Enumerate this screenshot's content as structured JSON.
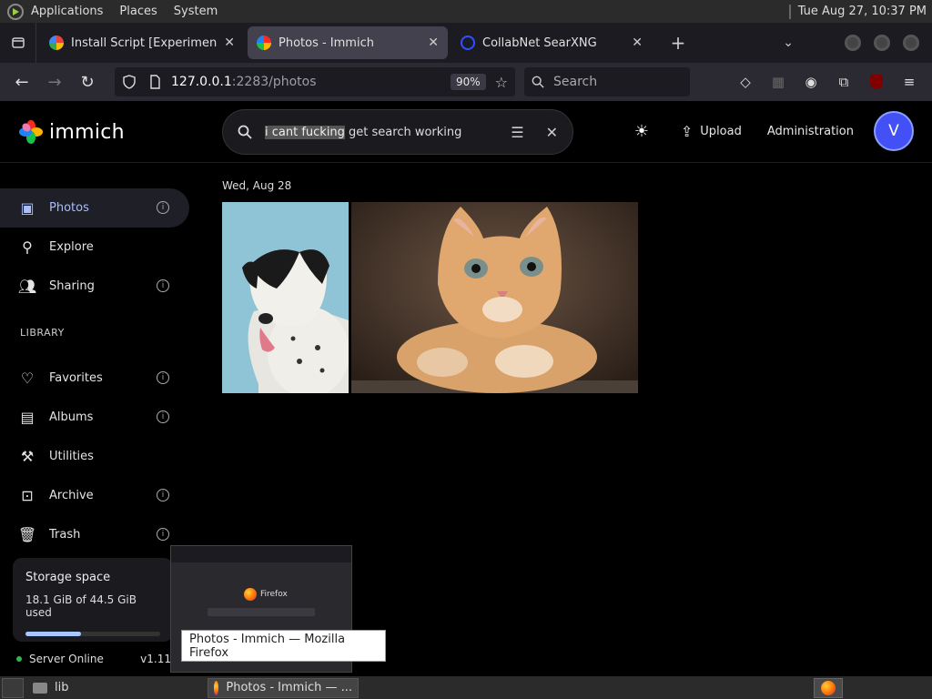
{
  "top_panel": {
    "menus": [
      "Applications",
      "Places",
      "System"
    ],
    "clock": "Tue Aug 27, 10:37 PM"
  },
  "browser": {
    "tabs": [
      {
        "label": "Install Script [Experimental]",
        "active": false
      },
      {
        "label": "Photos - Immich",
        "active": true
      },
      {
        "label": "CollabNet SearXNG",
        "active": false
      }
    ],
    "url_host": "127.0.0.1",
    "url_path": ":2283/photos",
    "zoom": "90%",
    "search_placeholder": "Search"
  },
  "immich": {
    "brand": "immich",
    "search": {
      "selected_text": "i cant fucking",
      "rest_text": " get search working"
    },
    "upload_label": "Upload",
    "admin_label": "Administration",
    "avatar_initial": "V",
    "sidebar": {
      "items": [
        {
          "label": "Photos"
        },
        {
          "label": "Explore"
        },
        {
          "label": "Sharing"
        }
      ],
      "library_heading": "LIBRARY",
      "library_items": [
        {
          "label": "Favorites"
        },
        {
          "label": "Albums"
        },
        {
          "label": "Utilities"
        },
        {
          "label": "Archive"
        },
        {
          "label": "Trash"
        }
      ]
    },
    "storage": {
      "title": "Storage space",
      "used_text": "18.1 GiB of 44.5 GiB used",
      "used_fraction": 0.41
    },
    "server": {
      "status": "Server Online",
      "version": "v1.11"
    },
    "date_group": "Wed, Aug 28"
  },
  "preview": {
    "app_name": "Firefox"
  },
  "tooltip": "Photos - Immich — Mozilla Firefox",
  "taskbar": {
    "items": [
      {
        "label": "lib"
      },
      {
        "label": "Photos - Immich — ..."
      }
    ]
  },
  "colors": {
    "accent": "#4250f5",
    "active_nav": "#a9bdff",
    "server_online": "#2fb74c"
  }
}
